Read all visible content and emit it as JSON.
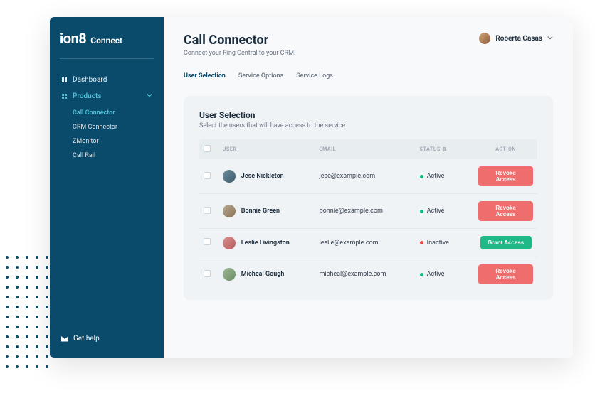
{
  "brand": {
    "main": "ion8",
    "sub": "Connect"
  },
  "sidebar": {
    "items": [
      {
        "label": "Dashboard",
        "active": false
      },
      {
        "label": "Products",
        "active": true
      }
    ],
    "subitems": [
      {
        "label": "Call Connector",
        "active": true
      },
      {
        "label": "CRM Connector",
        "active": false
      },
      {
        "label": "ZMonitor",
        "active": false
      },
      {
        "label": "Call Rail",
        "active": false
      }
    ],
    "help_label": "Get help"
  },
  "header": {
    "title": "Call Connector",
    "subtitle": "Connect your Ring Central to your CRM.",
    "user_name": "Roberta Casas"
  },
  "tabs": [
    {
      "label": "User Selection",
      "active": true
    },
    {
      "label": "Service Options",
      "active": false
    },
    {
      "label": "Service Logs",
      "active": false
    }
  ],
  "card": {
    "title": "User Selection",
    "subtitle": "Select the users that will have access to the service.",
    "columns": {
      "user": "USER",
      "email": "EMAIL",
      "status": "STATUS",
      "action": "ACTION"
    },
    "rows": [
      {
        "name": "Jese Nickleton",
        "email": "jese@example.com",
        "status": "Active",
        "status_class": "active",
        "action": "Revoke Access",
        "action_class": "revoke",
        "avatar": "av1"
      },
      {
        "name": "Bonnie Green",
        "email": "bonnie@example.com",
        "status": "Active",
        "status_class": "active",
        "action": "Revoke Access",
        "action_class": "revoke",
        "avatar": "av2"
      },
      {
        "name": "Leslie Livingston",
        "email": "leslie@example.com",
        "status": "Inactive",
        "status_class": "inactive",
        "action": "Grant Access",
        "action_class": "grant",
        "avatar": "av3"
      },
      {
        "name": "Micheal Gough",
        "email": "micheal@example.com",
        "status": "Active",
        "status_class": "active",
        "action": "Revoke Access",
        "action_class": "revoke",
        "avatar": "av4"
      }
    ]
  }
}
